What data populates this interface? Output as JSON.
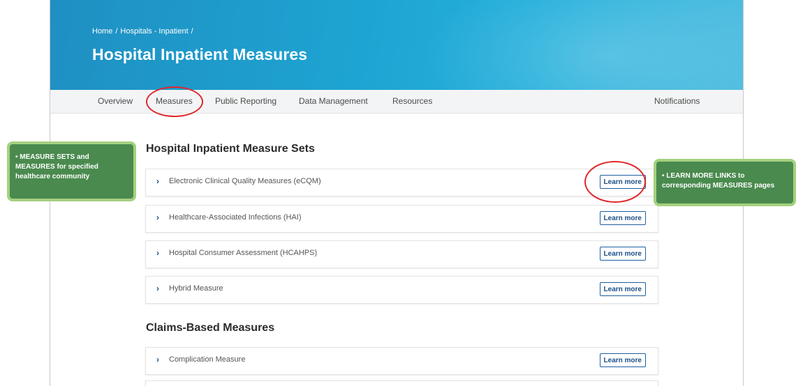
{
  "breadcrumb": {
    "home": "Home",
    "sep1": "/",
    "hospitals": "Hospitals - Inpatient",
    "sep2": "/"
  },
  "page_title": "Hospital Inpatient Measures",
  "tabs": {
    "overview": "Overview",
    "measures": "Measures",
    "public_reporting": "Public Reporting",
    "data_management": "Data Management",
    "resources": "Resources",
    "notifications": "Notifications"
  },
  "sections": {
    "measure_sets_title": "Hospital Inpatient Measure Sets",
    "claims_title": "Claims-Based Measures"
  },
  "measure_sets": [
    {
      "label": "Electronic Clinical Quality Measures (eCQM)",
      "button": "Learn more"
    },
    {
      "label": "Healthcare-Associated Infections (HAI)",
      "button": "Learn more"
    },
    {
      "label": "Hospital Consumer Assessment (HCAHPS)",
      "button": "Learn more"
    },
    {
      "label": "Hybrid Measure",
      "button": "Learn more"
    }
  ],
  "claims_measures": [
    {
      "label": "Complication Measure",
      "button": "Learn more"
    }
  ],
  "icons": {
    "expand": "chevron-right-icon",
    "chevron_glyph": "›"
  },
  "callouts": {
    "left": "• MEASURE SETS and MEASURES for specified healthcare community",
    "right": "• LEARN MORE LINKS to corresponding MEASURES pages"
  },
  "colors": {
    "hero": "#1ea4d2",
    "highlight_circle": "#e0262c",
    "callout_bg": "#4a8a4e",
    "callout_border": "#a4d07f",
    "button_border": "#1d5fa0"
  }
}
